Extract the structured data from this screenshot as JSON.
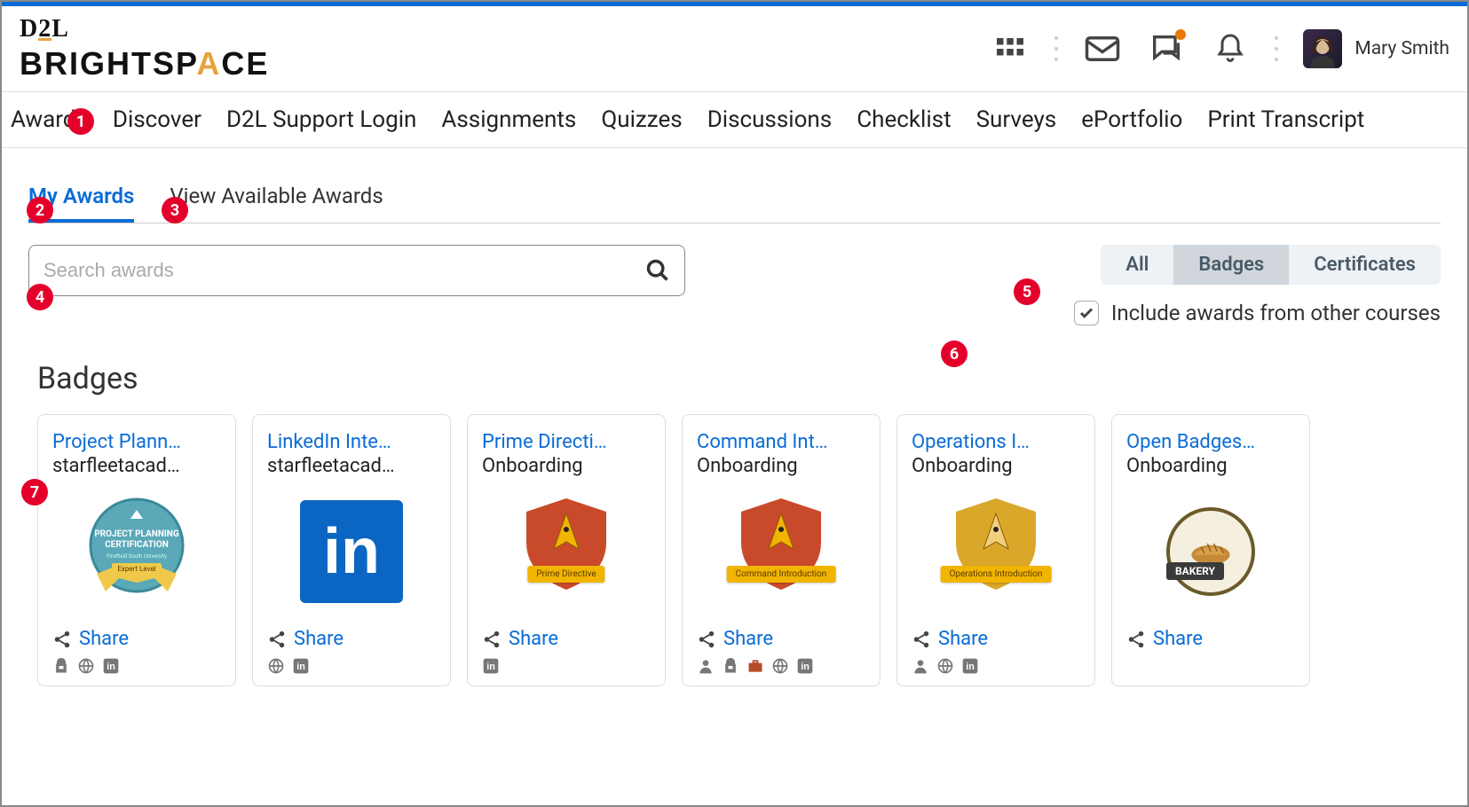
{
  "header": {
    "logo_line1": "D2L",
    "logo_line2_pre": "BRIGHTSP",
    "logo_line2_accent": "A",
    "logo_line2_post": "CE",
    "user_name": "Mary Smith"
  },
  "nav": {
    "items": [
      "Awards",
      "Discover",
      "D2L Support Login",
      "Assignments",
      "Quizzes",
      "Discussions",
      "Checklist",
      "Surveys",
      "ePortfolio",
      "Print Transcript"
    ]
  },
  "tabs": {
    "my_awards": "My Awards",
    "available": "View Available Awards"
  },
  "search": {
    "placeholder": "Search awards"
  },
  "filters": {
    "all": "All",
    "badges": "Badges",
    "certificates": "Certificates",
    "include_label": "Include awards from other courses",
    "include_checked": true
  },
  "section": {
    "badges_title": "Badges"
  },
  "share_label": "Share",
  "badges": [
    {
      "title": "Project Plann…",
      "subtitle": "starfleetacad…",
      "type": "cert",
      "ribbon": "Expert Level",
      "mini": [
        "backpack",
        "globe",
        "linkedin"
      ]
    },
    {
      "title": "LinkedIn Inte…",
      "subtitle": "starfleetacad…",
      "type": "linkedin",
      "mini": [
        "globe",
        "linkedin"
      ]
    },
    {
      "title": "Prime Directi…",
      "subtitle": "Onboarding",
      "type": "shield-red",
      "ribbon": "Prime Directive",
      "mini": [
        "linkedin"
      ]
    },
    {
      "title": "Command Int…",
      "subtitle": "Onboarding",
      "type": "shield-red",
      "ribbon": "Command Introduction",
      "mini": [
        "person",
        "backpack",
        "briefcase",
        "globe",
        "linkedin"
      ]
    },
    {
      "title": "Operations I…",
      "subtitle": "Onboarding",
      "type": "shield-gold",
      "ribbon": "Operations Introduction",
      "mini": [
        "person",
        "globe",
        "linkedin"
      ]
    },
    {
      "title": "Open Badges…",
      "subtitle": "Onboarding",
      "type": "bakery",
      "ribbon": "BAKERY",
      "mini": []
    }
  ],
  "annotations": [
    "1",
    "2",
    "3",
    "4",
    "5",
    "6",
    "7"
  ]
}
